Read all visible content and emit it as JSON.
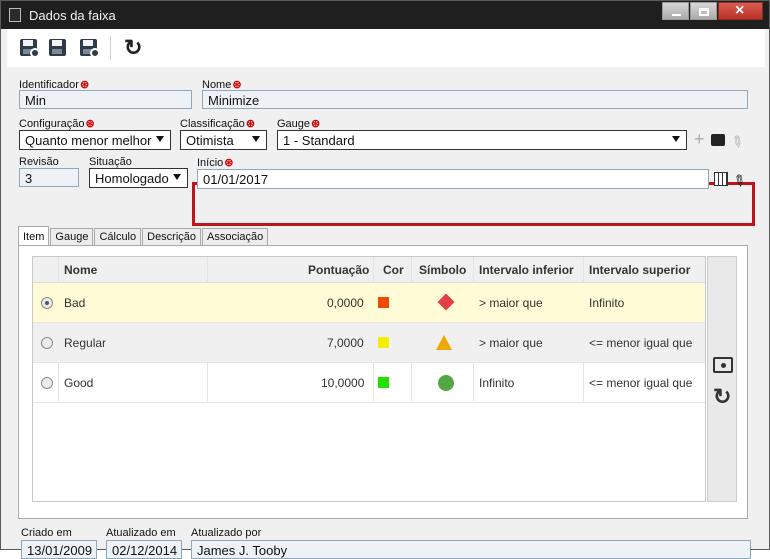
{
  "window": {
    "title": "Dados da faixa"
  },
  "toolbar": {
    "save_new": "Salvar e novo",
    "save": "Salvar",
    "save_close": "Salvar e sair",
    "refresh": "Atualizar"
  },
  "fields": {
    "identificador": {
      "label": "Identificador",
      "value": "Min"
    },
    "nome": {
      "label": "Nome",
      "value": "Minimize"
    },
    "configuracao": {
      "label": "Configuração",
      "value": "Quanto menor melhor"
    },
    "classificacao": {
      "label": "Classificação",
      "value": "Otimista"
    },
    "gauge": {
      "label": "Gauge",
      "value": "1 - Standard"
    },
    "revisao": {
      "label": "Revisão",
      "value": "3"
    },
    "situacao": {
      "label": "Situação",
      "value": "Homologado"
    },
    "inicio": {
      "label": "Início",
      "value": "01/01/2017"
    },
    "required_marker": "⊛"
  },
  "tabs": [
    "Item",
    "Gauge",
    "Cálculo",
    "Descrição",
    "Associação"
  ],
  "grid": {
    "headers": [
      "Nome",
      "Pontuação",
      "Cor",
      "Símbolo",
      "Intervalo inferior",
      "Intervalo superior"
    ],
    "rows": [
      {
        "nome": "Bad",
        "pontuacao": "0,0000",
        "color": "#f04a00",
        "symbol": "diamond-icon",
        "inferior": "> maior que",
        "superior": "Infinito"
      },
      {
        "nome": "Regular",
        "pontuacao": "7,0000",
        "color": "#f5ee00",
        "symbol": "triangle-icon",
        "inferior": "> maior que",
        "superior": "<= menor igual que"
      },
      {
        "nome": "Good",
        "pontuacao": "10,0000",
        "color": "#22e000",
        "symbol": "circle-icon",
        "inferior": "Infinito",
        "superior": "<= menor igual que"
      }
    ]
  },
  "footer": {
    "criado_em": {
      "label": "Criado em",
      "value": "13/01/2009"
    },
    "atualizado_em": {
      "label": "Atualizado em",
      "value": "02/12/2014"
    },
    "atualizado_por": {
      "label": "Atualizado por",
      "value": "James J. Tooby"
    }
  }
}
